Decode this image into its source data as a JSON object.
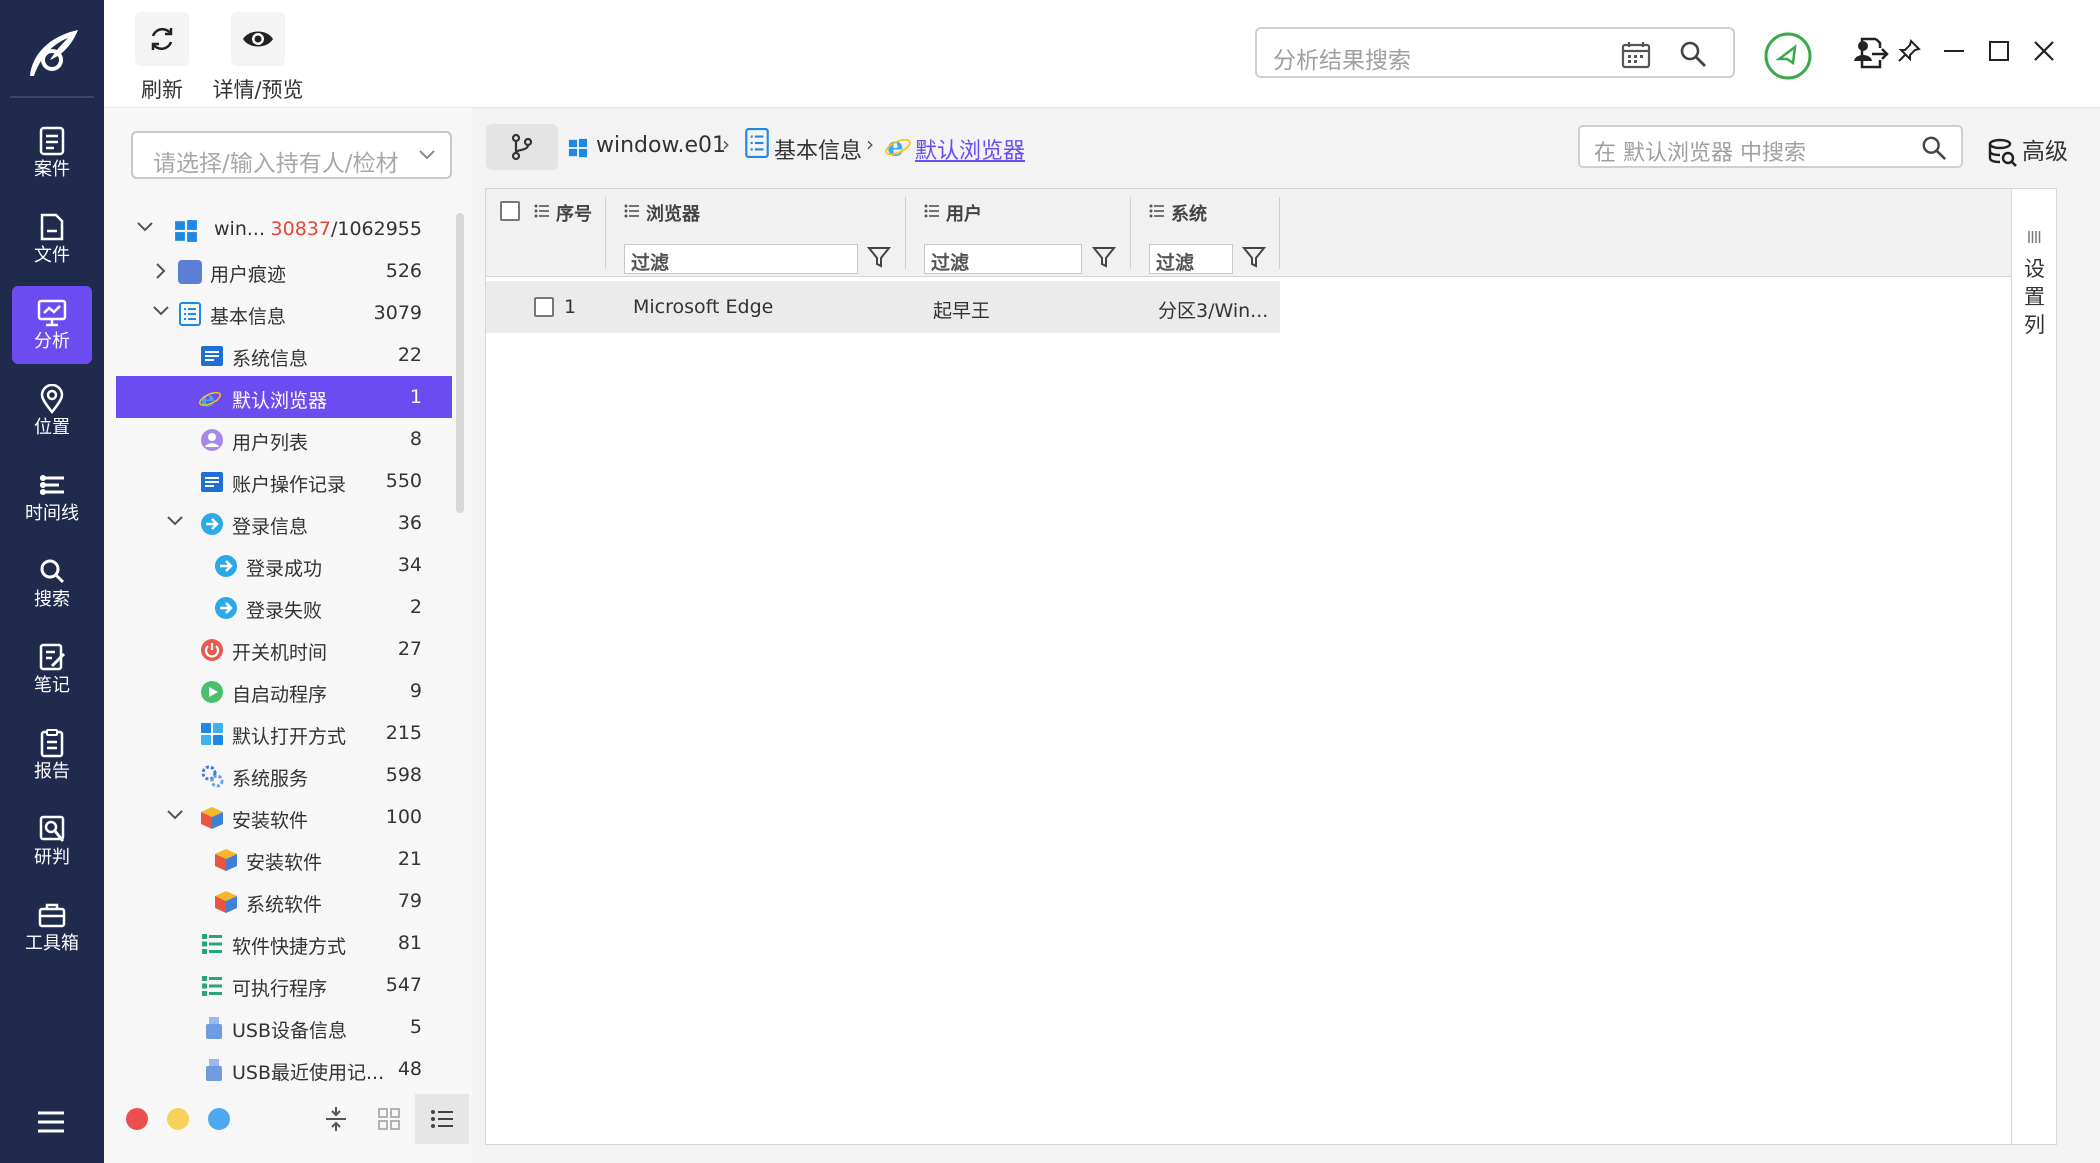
{
  "nav": {
    "items": [
      {
        "label": "案件",
        "icon": "case-icon"
      },
      {
        "label": "文件",
        "icon": "file-icon"
      },
      {
        "label": "分析",
        "icon": "analysis-icon",
        "active": true
      },
      {
        "label": "位置",
        "icon": "location-icon"
      },
      {
        "label": "时间线",
        "icon": "timeline-icon"
      },
      {
        "label": "搜索",
        "icon": "search-icon"
      },
      {
        "label": "笔记",
        "icon": "notes-icon"
      },
      {
        "label": "报告",
        "icon": "report-icon"
      },
      {
        "label": "研判",
        "icon": "judgment-icon"
      },
      {
        "label": "工具箱",
        "icon": "toolbox-icon"
      }
    ]
  },
  "toolbar": {
    "refresh_label": "刷新",
    "preview_label": "详情/预览",
    "search_placeholder": "分析结果搜索"
  },
  "tree_panel": {
    "owner_placeholder": "请选择/输入持有人/检材",
    "items": [
      {
        "label": "win...",
        "count_hl": "30837",
        "count": "/1062955",
        "icon": "windows-icon",
        "expand": "down"
      },
      {
        "label": "用户痕迹",
        "count": "526",
        "icon": "user-trace-icon",
        "expand": "right"
      },
      {
        "label": "基本信息",
        "count": "3079",
        "icon": "basic-info-icon",
        "expand": "down"
      },
      {
        "label": "系统信息",
        "count": "22",
        "icon": "system-info-icon"
      },
      {
        "label": "默认浏览器",
        "count": "1",
        "icon": "ie-browser-icon",
        "selected": true
      },
      {
        "label": "用户列表",
        "count": "8",
        "icon": "user-list-icon"
      },
      {
        "label": "账户操作记录",
        "count": "550",
        "icon": "account-log-icon"
      },
      {
        "label": "登录信息",
        "count": "36",
        "icon": "login-icon",
        "expand": "down"
      },
      {
        "label": "登录成功",
        "count": "34",
        "icon": "login-success-icon"
      },
      {
        "label": "登录失败",
        "count": "2",
        "icon": "login-fail-icon"
      },
      {
        "label": "开关机时间",
        "count": "27",
        "icon": "power-icon"
      },
      {
        "label": "自启动程序",
        "count": "9",
        "icon": "autostart-icon"
      },
      {
        "label": "默认打开方式",
        "count": "215",
        "icon": "default-open-icon"
      },
      {
        "label": "系统服务",
        "count": "598",
        "icon": "service-icon"
      },
      {
        "label": "安装软件",
        "count": "100",
        "icon": "software-icon",
        "expand": "down"
      },
      {
        "label": "安装软件",
        "count": "21",
        "icon": "software-icon"
      },
      {
        "label": "系统软件",
        "count": "79",
        "icon": "software-icon"
      },
      {
        "label": "软件快捷方式",
        "count": "81",
        "icon": "shortcut-icon"
      },
      {
        "label": "可执行程序",
        "count": "547",
        "icon": "executable-icon"
      },
      {
        "label": "USB设备信息",
        "count": "5",
        "icon": "usb-icon"
      },
      {
        "label": "USB最近使用记...",
        "count": "48",
        "icon": "usb-icon"
      }
    ]
  },
  "main": {
    "breadcrumb": [
      "window.e01",
      "基本信息",
      "默认浏览器"
    ],
    "search_placeholder": "在 默认浏览器 中搜索",
    "advanced_label": "高级",
    "columns": [
      "序号",
      "浏览器",
      "用户",
      "系统"
    ],
    "filter_placeholder": "过滤",
    "rows": [
      {
        "index": "1",
        "browser": "Microsoft Edge",
        "user": "起早王",
        "system": "分区3/Win..."
      }
    ],
    "settings_label": "设置列"
  },
  "colors": {
    "rail": "#1f2a4d",
    "accent": "#6a4cf0",
    "count_highlight": "#e0483a",
    "status_green": "#3aa84a"
  }
}
